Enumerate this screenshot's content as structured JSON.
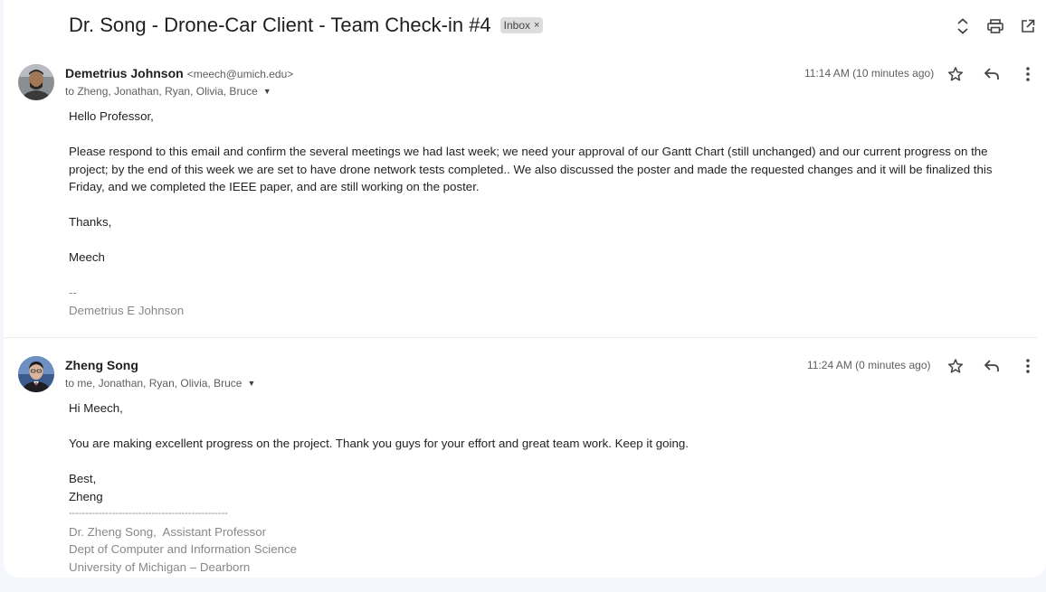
{
  "thread": {
    "subject": "Dr. Song - Drone-Car Client - Team Check-in #4",
    "label": "Inbox",
    "label_remove": "×"
  },
  "toolbar_icons": [
    "expand-collapse-icon",
    "print-icon",
    "open-in-new-window-icon"
  ],
  "messages": [
    {
      "sender_name": "Demetrius Johnson",
      "sender_email": "<meech@umich.edu>",
      "recipients": "to Zheng, Jonathan, Ryan, Olivia, Bruce",
      "time": "11:14 AM (10 minutes ago)",
      "greeting": "Hello Professor,",
      "paragraph": "Please respond to this email and confirm the several meetings we had last week; we need your approval of our Gantt Chart (still unchanged) and our current progress on the project; by the end of this week we are set to have drone network tests completed.. We also discussed the poster and made the requested changes and it will be finalized this Friday, and we completed the IEEE paper, and are still working on the poster.",
      "closing": "Thanks,",
      "signoff": "Meech",
      "sig_dash": "--",
      "sig_name": "Demetrius E Johnson"
    },
    {
      "sender_name": "Zheng Song",
      "recipients": "to me, Jonathan, Ryan, Olivia, Bruce",
      "time": "11:24 AM (0 minutes ago)",
      "greeting": "Hi Meech,",
      "paragraph": "You are making excellent progress on the project. Thank you guys for your effort and great team work. Keep it going.",
      "closing": "Best,",
      "signoff": "Zheng",
      "sig_rule": "------------------------------------------------",
      "sig_line1": "Dr. Zheng Song,  Assistant Professor",
      "sig_line2": "Dept of Computer and Information Science",
      "sig_line3": "University of Michigan – Dearborn"
    }
  ],
  "colors": {
    "page_bg": "#f3f6fb",
    "card_bg": "#ffffff",
    "muted_text": "#5e5e5e",
    "signature_text": "#888888"
  }
}
